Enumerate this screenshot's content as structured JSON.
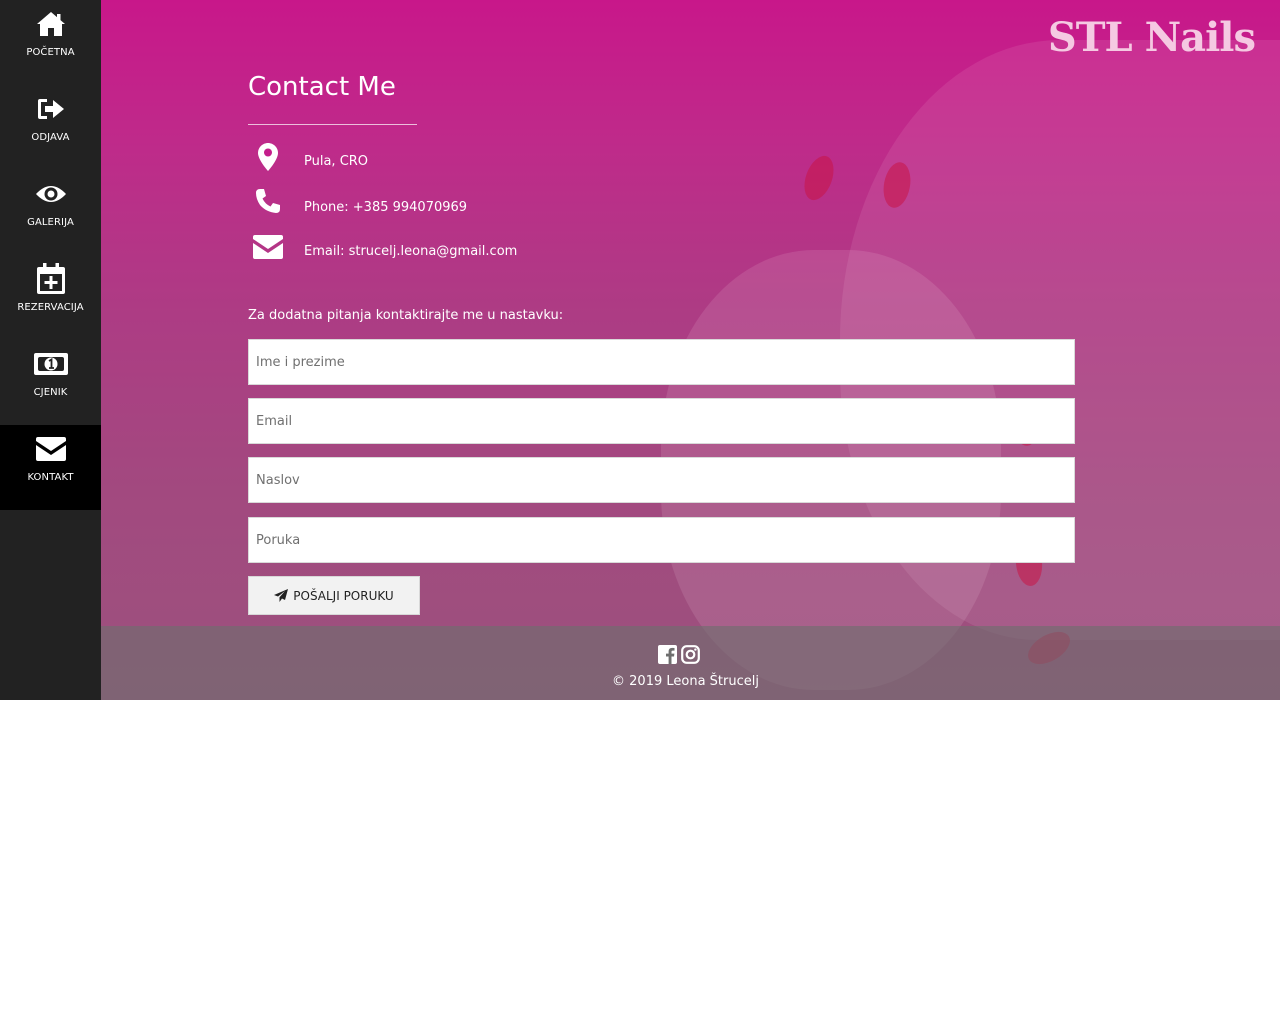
{
  "sidebar": {
    "items": [
      {
        "label": "POČETNA",
        "icon": "home-icon"
      },
      {
        "label": "ODJAVA",
        "icon": "sign-out-icon"
      },
      {
        "label": "GALERIJA",
        "icon": "eye-icon"
      },
      {
        "label": "REZERVACIJA",
        "icon": "calendar-plus-icon"
      },
      {
        "label": "CJENIK",
        "icon": "money-bill-icon"
      },
      {
        "label": "KONTAKT",
        "icon": "envelope-icon",
        "active": true
      }
    ]
  },
  "brand": "STL Nails",
  "contact": {
    "title": "Contact Me",
    "location": "Pula, CRO",
    "phone": "Phone: +385 994070969",
    "email": "Email: strucelj.leona@gmail.com"
  },
  "form": {
    "prompt": "Za dodatna pitanja kontaktirajte me u nastavku:",
    "name_placeholder": "Ime i prezime",
    "email_placeholder": "Email",
    "subject_placeholder": "Naslov",
    "message_placeholder": "Poruka",
    "send_label": "POŠALJI PORUKU"
  },
  "footer": {
    "copyright": "© 2019 Leona Štrucelj",
    "social": [
      "facebook-icon",
      "instagram-icon"
    ]
  },
  "colors": {
    "sidebar": "#222222",
    "sidebar_active": "#000000",
    "accent_pink": "#c8178a",
    "brand_text": "#f5c9e2"
  }
}
